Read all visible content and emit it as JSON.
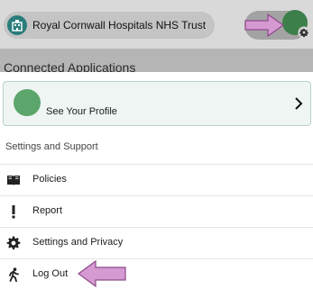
{
  "header": {
    "org_name": "Royal Cornwall Hospitals NHS Trust",
    "avatar_icon": "user-avatar",
    "settings_badge_icon": "gear-icon"
  },
  "background": {
    "section_title": "Connected Applications"
  },
  "profile": {
    "label": "See Your Profile",
    "chevron_icon": "chevron-right-icon"
  },
  "settings": {
    "title": "Settings and Support",
    "items": [
      {
        "label": "Policies",
        "icon": "book-icon"
      },
      {
        "label": "Report",
        "icon": "exclamation-icon"
      },
      {
        "label": "Settings and Privacy",
        "icon": "gear-icon"
      },
      {
        "label": "Log Out",
        "icon": "running-person-icon"
      }
    ]
  },
  "colors": {
    "accent_green": "#5ca66b",
    "highlight_arrow": "#d59ad1"
  }
}
